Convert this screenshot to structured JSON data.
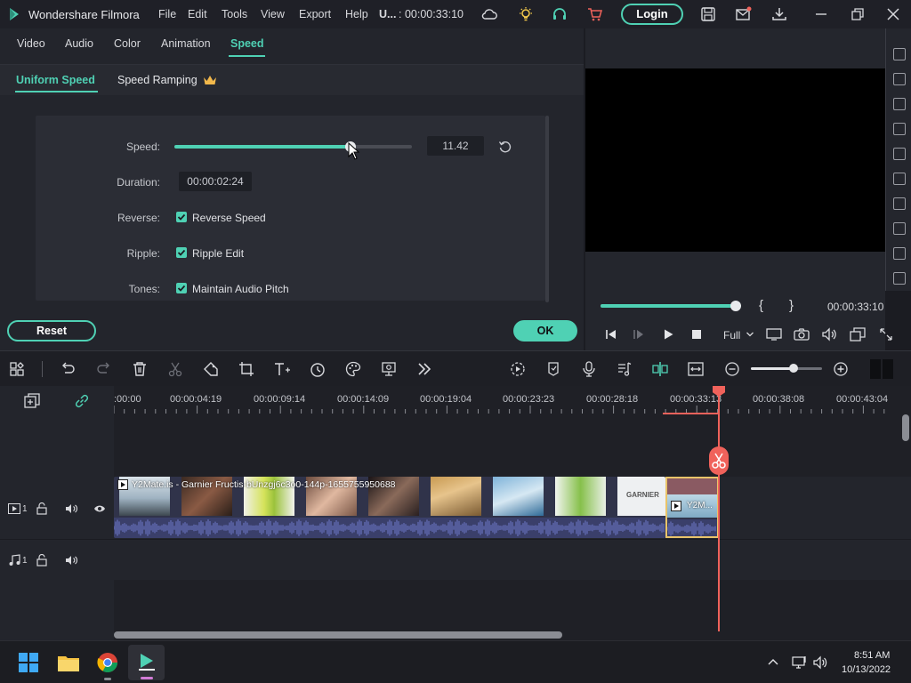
{
  "app": {
    "title": "Wondershare Filmora",
    "menu": [
      "File",
      "Edit",
      "Tools",
      "View",
      "Export",
      "Help"
    ],
    "project_name": "U...",
    "project_time": ": 00:00:33:10",
    "login_label": "Login"
  },
  "tabs": [
    "Video",
    "Audio",
    "Color",
    "Animation",
    "Speed"
  ],
  "active_tab": "Speed",
  "subtabs": {
    "uniform": "Uniform Speed",
    "ramping": "Speed Ramping"
  },
  "speed_panel": {
    "speed_label": "Speed:",
    "speed_value": "11.42",
    "speed_slider_fraction": 0.74,
    "duration_label": "Duration:",
    "duration_value": "00:00:02:24",
    "reverse_label": "Reverse:",
    "reverse_check": "Reverse Speed",
    "ripple_label": "Ripple:",
    "ripple_check": "Ripple Edit",
    "tones_label": "Tones:",
    "tones_check": "Maintain Audio Pitch"
  },
  "buttons": {
    "reset": "Reset",
    "ok": "OK"
  },
  "preview": {
    "timecode": "00:00:33:10",
    "progress_fraction": 1.0,
    "bracket_in": "{",
    "bracket_out": "}",
    "quality": "Full"
  },
  "timeline": {
    "ruler": [
      ":00:00",
      "00:00:04:19",
      "00:00:09:14",
      "00:00:14:09",
      "00:00:19:04",
      "00:00:23:23",
      "00:00:28:18",
      "00:00:33:13",
      "00:00:38:08",
      "00:00:43:04"
    ],
    "zoom_fraction": 0.6,
    "video_track_num": "1",
    "audio_track_num": "1",
    "clip_title": "Y2Mate.is - Garnier Fructis-bUnzgj6c3o0-144p-1655755950688",
    "clip2_title": "Y2M...",
    "thumb_text": "GARNIER"
  },
  "taskbar": {
    "time": "8:51 AM",
    "date": "10/13/2022"
  },
  "colors": {
    "accent": "#4fd1b4",
    "playhead": "#f0625b",
    "audio_wave": "#6d78c9"
  }
}
